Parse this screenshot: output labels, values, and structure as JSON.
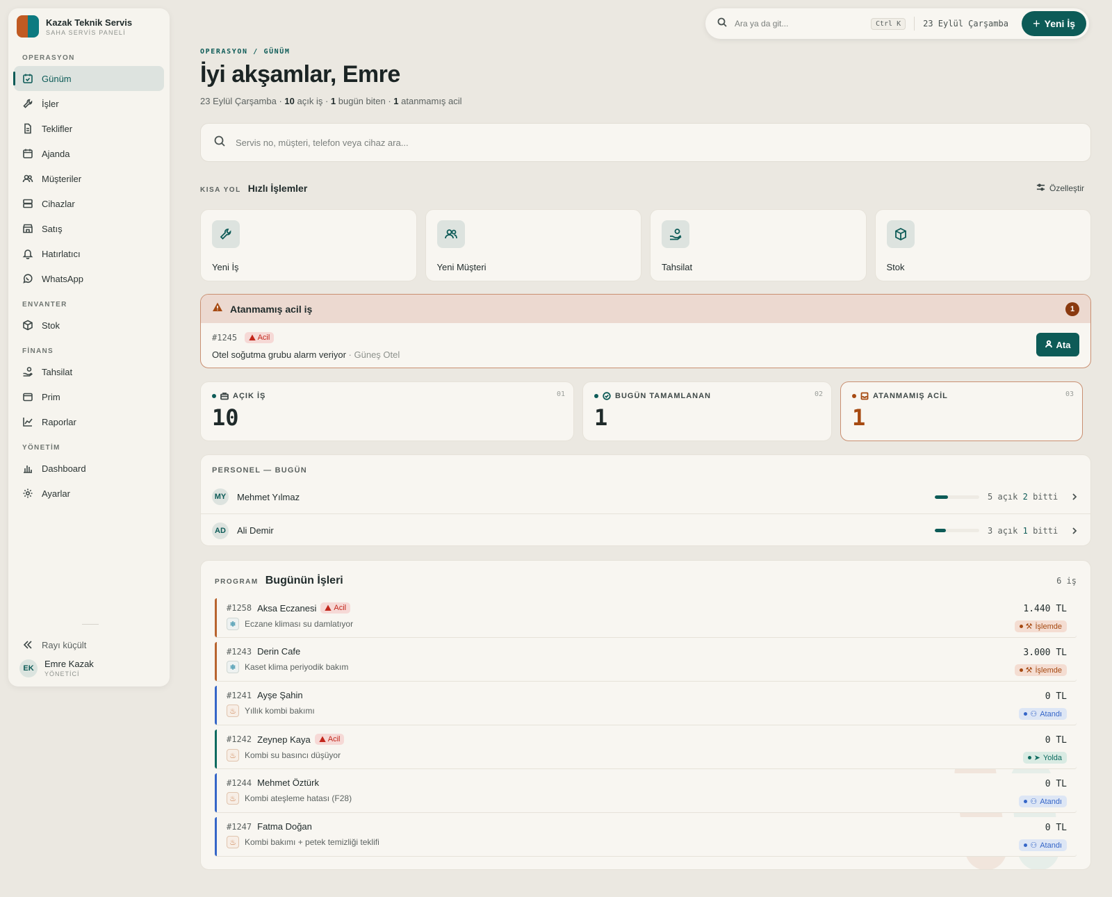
{
  "brand": {
    "name": "Kazak Teknik Servis",
    "sub": "SAHA SERVİS PANELİ",
    "color_a": "#c05a22",
    "color_b": "#0d7a80"
  },
  "sidebar": {
    "sections": [
      {
        "title": "OPERASYON",
        "items": [
          {
            "label": "Günüm",
            "icon": "calendar-check-icon"
          },
          {
            "label": "İşler",
            "icon": "wrench-icon"
          },
          {
            "label": "Teklifler",
            "icon": "document-icon"
          },
          {
            "label": "Ajanda",
            "icon": "calendar-icon"
          },
          {
            "label": "Müşteriler",
            "icon": "users-icon"
          },
          {
            "label": "Cihazlar",
            "icon": "server-icon"
          },
          {
            "label": "Satış",
            "icon": "store-icon"
          },
          {
            "label": "Hatırlatıcı",
            "icon": "bell-icon"
          },
          {
            "label": "WhatsApp",
            "icon": "whatsapp-icon"
          }
        ]
      },
      {
        "title": "ENVANTER",
        "items": [
          {
            "label": "Stok",
            "icon": "box-icon"
          }
        ]
      },
      {
        "title": "FİNANS",
        "items": [
          {
            "label": "Tahsilat",
            "icon": "hand-coin-icon"
          },
          {
            "label": "Prim",
            "icon": "wallet-icon"
          },
          {
            "label": "Raporlar",
            "icon": "chart-line-icon"
          }
        ]
      },
      {
        "title": "YÖNETİM",
        "items": [
          {
            "label": "Dashboard",
            "icon": "bar-chart-icon"
          },
          {
            "label": "Ayarlar",
            "icon": "gear-icon"
          }
        ]
      }
    ],
    "collapse_label": "Rayı küçült",
    "user": {
      "initials": "EK",
      "name": "Emre Kazak",
      "role": "YÖNETİCİ"
    }
  },
  "topbar": {
    "search_placeholder": "Ara ya da git...",
    "shortcut": "Ctrl K",
    "date": "23 Eylül Çarşamba",
    "new_label": "Yeni İş"
  },
  "header": {
    "breadcrumb": "OPERASYON / GÜNÜM",
    "greeting": "İyi akşamlar, Emre",
    "summary": {
      "date": "23 Eylül Çarşamba",
      "open_count": "10",
      "open_text": "açık iş",
      "done_count": "1",
      "done_text": "bugün biten",
      "urgent_count": "1",
      "urgent_text": "atanmamış acil"
    }
  },
  "main_search": {
    "placeholder": "Servis no, müşteri, telefon veya cihaz ara..."
  },
  "quick": {
    "kicker": "KISA YOL",
    "title": "Hızlı İşlemler",
    "customize": "Özelleştir",
    "items": [
      {
        "label": "Yeni İş",
        "icon": "wrench-icon"
      },
      {
        "label": "Yeni Müşteri",
        "icon": "users-icon"
      },
      {
        "label": "Tahsilat",
        "icon": "hand-coin-icon"
      },
      {
        "label": "Stok",
        "icon": "box-icon"
      }
    ]
  },
  "alert": {
    "title": "Atanmamış acil iş",
    "count": "1",
    "job": {
      "no": "#1245",
      "tag": "Acil",
      "desc": "Otel soğutma grubu alarm veriyor",
      "customer": "Güneş Otel"
    },
    "assign_label": "Ata"
  },
  "stats": [
    {
      "label": "AÇIK İŞ",
      "value": "10",
      "index": "01",
      "color": "#1f2a2a"
    },
    {
      "label": "BUGÜN TAMAMLANAN",
      "value": "1",
      "index": "02",
      "color": "#1f2a2a"
    },
    {
      "label": "ATANMAMIŞ ACİL",
      "value": "1",
      "index": "03",
      "color": "#a64a12"
    }
  ],
  "staff": {
    "title": "PERSONEL — BUGÜN",
    "open_word": "açık",
    "done_word": "bitti",
    "rows": [
      {
        "initials": "MY",
        "name": "Mehmet Yılmaz",
        "open": "5",
        "done": "2",
        "progress": 0.29
      },
      {
        "initials": "AD",
        "name": "Ali Demir",
        "open": "3",
        "done": "1",
        "progress": 0.25
      }
    ]
  },
  "program": {
    "kicker": "PROGRAM",
    "title": "Bugünün İşleri",
    "count": "6 iş",
    "jobs": [
      {
        "no": "#1258",
        "customer": "Aksa Eczanesi",
        "urgent": true,
        "tag": "Acil",
        "desc": "Eczane kliması su damlatıyor",
        "type": "ac",
        "amount": "1.440 TL",
        "status": "İşlemde",
        "status_kind": "progress",
        "accent": "#b8642f"
      },
      {
        "no": "#1243",
        "customer": "Derin Cafe",
        "urgent": false,
        "tag": "",
        "desc": "Kaset klima periyodik bakım",
        "type": "ac",
        "amount": "3.000 TL",
        "status": "İşlemde",
        "status_kind": "progress",
        "accent": "#b8642f"
      },
      {
        "no": "#1241",
        "customer": "Ayşe Şahin",
        "urgent": false,
        "tag": "",
        "desc": "Yıllık kombi bakımı",
        "type": "boiler",
        "amount": "0 TL",
        "status": "Atandı",
        "status_kind": "assigned",
        "accent": "#3566c8"
      },
      {
        "no": "#1242",
        "customer": "Zeynep Kaya",
        "urgent": true,
        "tag": "Acil",
        "desc": "Kombi su basıncı düşüyor",
        "type": "boiler",
        "amount": "0 TL",
        "status": "Yolda",
        "status_kind": "onroute",
        "accent": "#0d6b5f"
      },
      {
        "no": "#1244",
        "customer": "Mehmet Öztürk",
        "urgent": false,
        "tag": "",
        "desc": "Kombi ateşleme hatası (F28)",
        "type": "boiler",
        "amount": "0 TL",
        "status": "Atandı",
        "status_kind": "assigned",
        "accent": "#3566c8"
      },
      {
        "no": "#1247",
        "customer": "Fatma Doğan",
        "urgent": false,
        "tag": "",
        "desc": "Kombi bakımı + petek temizliği teklifi",
        "type": "boiler",
        "amount": "0 TL",
        "status": "Atandı",
        "status_kind": "assigned",
        "accent": "#3566c8"
      }
    ]
  },
  "colors": {
    "primary": "#0d5b57",
    "urgent": "#c2271c",
    "accent_orange": "#a64a12",
    "bg": "#ebe8e1"
  }
}
